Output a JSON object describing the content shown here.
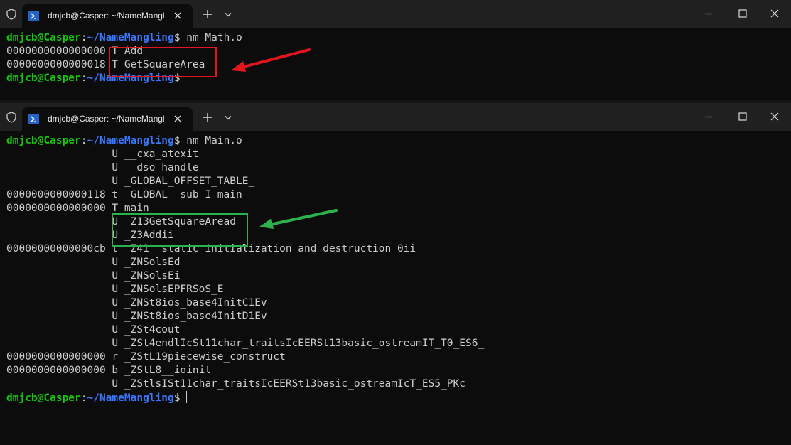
{
  "window1": {
    "tab_title": "dmjcb@Casper: ~/NameMangling",
    "lines": [
      {
        "user": "dmjcb@Casper",
        "sep": ":",
        "path": "~/NameMangling",
        "prompt": "$ ",
        "cmd": "nm Math.o"
      },
      {
        "text": "0000000000000000 T Add"
      },
      {
        "text": "0000000000000018 T GetSquareArea"
      },
      {
        "user": "dmjcb@Casper",
        "sep": ":",
        "path": "~/NameMangling",
        "prompt": "$",
        "cmd": ""
      }
    ]
  },
  "window2": {
    "tab_title": "dmjcb@Casper: ~/NameMangling",
    "lines": [
      {
        "user": "dmjcb@Casper",
        "sep": ":",
        "path": "~/NameMangling",
        "prompt": "$ ",
        "cmd": "nm Main.o"
      },
      {
        "text": "                 U __cxa_atexit"
      },
      {
        "text": "                 U __dso_handle"
      },
      {
        "text": "                 U _GLOBAL_OFFSET_TABLE_"
      },
      {
        "text": "0000000000000118 t _GLOBAL__sub_I_main"
      },
      {
        "text": "0000000000000000 T main"
      },
      {
        "text": "                 U _Z13GetSquareAread"
      },
      {
        "text": "                 U _Z3Addii"
      },
      {
        "text": "00000000000000cb t _Z41__static_initialization_and_destruction_0ii"
      },
      {
        "text": "                 U _ZNSolsEd"
      },
      {
        "text": "                 U _ZNSolsEi"
      },
      {
        "text": "                 U _ZNSolsEPFRSoS_E"
      },
      {
        "text": "                 U _ZNSt8ios_base4InitC1Ev"
      },
      {
        "text": "                 U _ZNSt8ios_base4InitD1Ev"
      },
      {
        "text": "                 U _ZSt4cout"
      },
      {
        "text": "                 U _ZSt4endlIcSt11char_traitsIcEERSt13basic_ostreamIT_T0_ES6_"
      },
      {
        "text": "0000000000000000 r _ZStL19piecewise_construct"
      },
      {
        "text": "0000000000000000 b _ZStL8__ioinit"
      },
      {
        "text": "                 U _ZStlsISt11char_traitsIcEERSt13basic_ostreamIcT_ES5_PKc"
      },
      {
        "user": "dmjcb@Casper",
        "sep": ":",
        "path": "~/NameMangling",
        "prompt": "$",
        "cmd": ""
      }
    ]
  },
  "colors": {
    "background": "#0c0c0c",
    "titlebar": "#202020",
    "text": "#cccccc",
    "prompt_user": "#16c60c",
    "prompt_path": "#3b78ff",
    "annotation_red": "#e2141c",
    "annotation_green": "#2bb24c"
  },
  "icons": [
    "shield-icon",
    "powershell-icon",
    "close-icon",
    "plus-icon",
    "chevron-down-icon",
    "minimize-icon",
    "maximize-icon",
    "close-window-icon"
  ]
}
